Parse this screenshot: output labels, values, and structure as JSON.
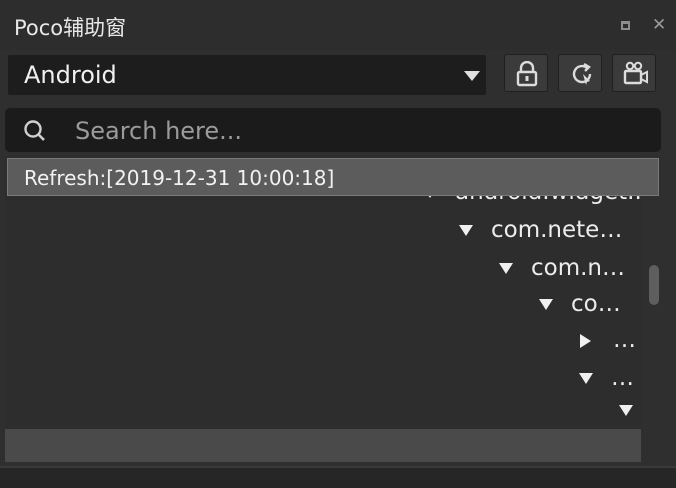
{
  "window": {
    "title": "Poco辅助窗",
    "close_glyph": "✕"
  },
  "toolbar": {
    "device_selected": "Android",
    "buttons": [
      {
        "icon": "lock-icon"
      },
      {
        "icon": "refresh-icon"
      },
      {
        "icon": "camera-icon"
      }
    ]
  },
  "search": {
    "placeholder": "Search here..."
  },
  "tooltip": {
    "text": "Refresh:[2019-12-31 10:00:18]"
  },
  "tree": {
    "nodes": [
      {
        "label": "android.widget...",
        "expanded": true
      },
      {
        "label": "com.nete…",
        "expanded": true
      },
      {
        "label": "com.n…",
        "expanded": true
      },
      {
        "label": "co…",
        "expanded": true
      },
      {
        "label": "…",
        "expanded": false
      },
      {
        "label": "…",
        "expanded": true
      },
      {
        "label": "",
        "expanded": true
      }
    ]
  },
  "colors": {
    "background": "#2f2f2f",
    "input_bg": "#1b1b1b",
    "tooltip_bg": "#5c5c5c"
  }
}
